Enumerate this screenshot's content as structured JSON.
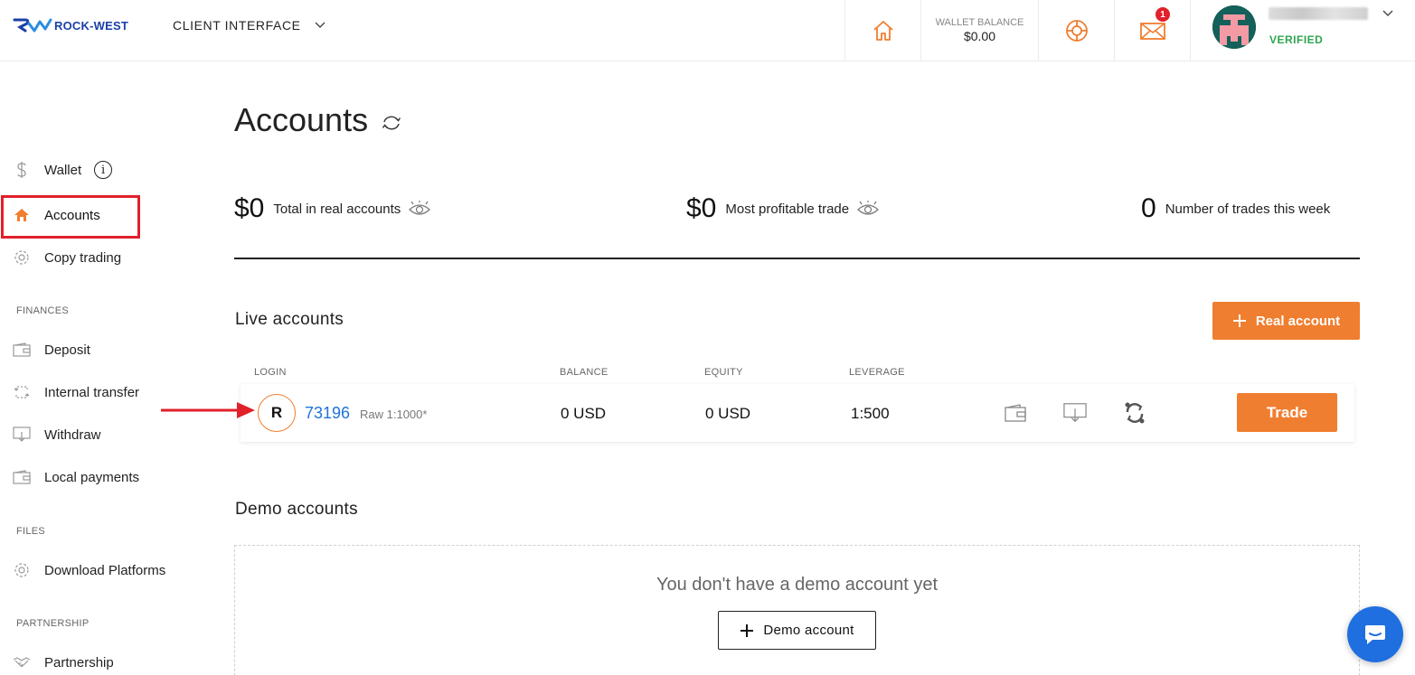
{
  "header": {
    "brand": "ROCK-WEST",
    "client_interface": "CLIENT INTERFACE",
    "wallet_balance_label": "WALLET BALANCE",
    "wallet_balance_value": "$0.00",
    "mail_badge": "1",
    "user_status": "VERIFIED"
  },
  "sidebar": {
    "items": [
      {
        "label": "Wallet",
        "icon": "dollar-icon"
      },
      {
        "label": "Accounts",
        "icon": "home-icon"
      },
      {
        "label": "Copy trading",
        "icon": "gear-icon"
      }
    ],
    "finances_heading": "FINANCES",
    "finances": [
      {
        "label": "Deposit",
        "icon": "wallet-icon"
      },
      {
        "label": "Internal transfer",
        "icon": "transfer-icon"
      },
      {
        "label": "Withdraw",
        "icon": "withdraw-icon"
      },
      {
        "label": "Local payments",
        "icon": "wallet-icon"
      }
    ],
    "files_heading": "FILES",
    "files": [
      {
        "label": "Download Platforms",
        "icon": "gear-icon"
      }
    ],
    "partnership_heading": "PARTNERSHIP",
    "partnership": [
      {
        "label": "Partnership",
        "icon": "handshake-icon"
      }
    ]
  },
  "main": {
    "title": "Accounts",
    "stats": [
      {
        "value": "$0",
        "label": "Total in real accounts"
      },
      {
        "value": "$0",
        "label": "Most profitable trade"
      },
      {
        "value": "0",
        "label": "Number of trades this week"
      }
    ],
    "live_title": "Live accounts",
    "real_account_button": "Real account",
    "columns": [
      "LOGIN",
      "BALANCE",
      "EQUITY",
      "LEVERAGE"
    ],
    "accounts": [
      {
        "badge": "R",
        "login": "73196",
        "type": "Raw 1:1000*",
        "balance": "0 USD",
        "equity": "0 USD",
        "leverage": "1:500",
        "trade_label": "Trade"
      }
    ],
    "demo_title": "Demo accounts",
    "demo_empty": "You don't have a demo account yet",
    "demo_button": "Demo account"
  },
  "colors": {
    "accent": "#f07e30",
    "brand_blue": "#1a3fa8",
    "link_blue": "#1e73d8",
    "verified_green": "#2fa44f",
    "highlight_red": "#e0202a",
    "chat_blue": "#1f6fe0"
  }
}
